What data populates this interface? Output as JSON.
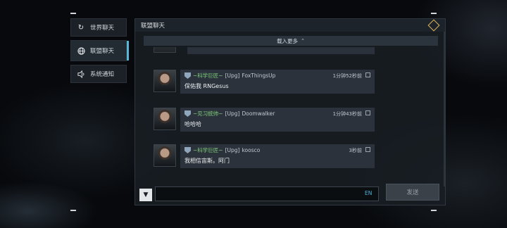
{
  "sidebar": {
    "items": [
      {
        "label": "世界聊天",
        "icon": "refresh-icon"
      },
      {
        "label": "联盟聊天",
        "icon": "globe-icon"
      },
      {
        "label": "系统通知",
        "icon": "speaker-icon"
      }
    ]
  },
  "panel": {
    "title": "联盟聊天",
    "header_icon": "diamond-arrow-icon",
    "load_more": "载入更多"
  },
  "messages": [
    {
      "rank": "~科学巨匠~",
      "tag": "[Upg]",
      "player": "FoxThingsUp",
      "time": "1分钟52秒前",
      "text": "保佑我 RNGesus"
    },
    {
      "rank": "~见习统帅~",
      "tag": "[Upg]",
      "player": "Doomwalker",
      "time": "1分钟43秒前",
      "text": "哈哈哈"
    },
    {
      "rank": "~科学巨匠~",
      "tag": "[Upg]",
      "player": "koosco",
      "time": "3秒前",
      "text": "我相信宙斯。阿门"
    }
  ],
  "input": {
    "value": "",
    "lang": "EN",
    "send_label": "发送"
  },
  "colors": {
    "accent": "#58b7d6",
    "rank_green": "#7fd17a",
    "lang_blue": "#4fb6dd"
  }
}
